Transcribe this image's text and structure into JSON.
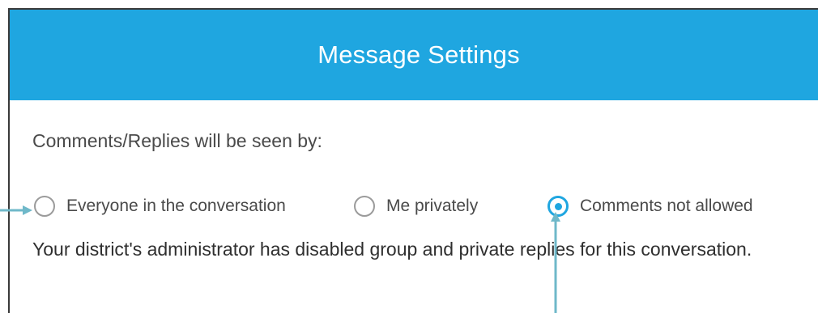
{
  "dialog": {
    "title": "Message Settings"
  },
  "comments": {
    "label": "Comments/Replies will be seen by:",
    "options": [
      {
        "label": "Everyone in the conversation",
        "selected": false
      },
      {
        "label": "Me privately",
        "selected": false
      },
      {
        "label": "Comments not allowed",
        "selected": true
      }
    ],
    "notice": "Your district's administrator has disabled group and private replies for this conversation."
  },
  "colors": {
    "header_bg": "#1fa6e0",
    "accent": "#1fa6e0",
    "annotation_arrow": "#6fb8c9"
  }
}
